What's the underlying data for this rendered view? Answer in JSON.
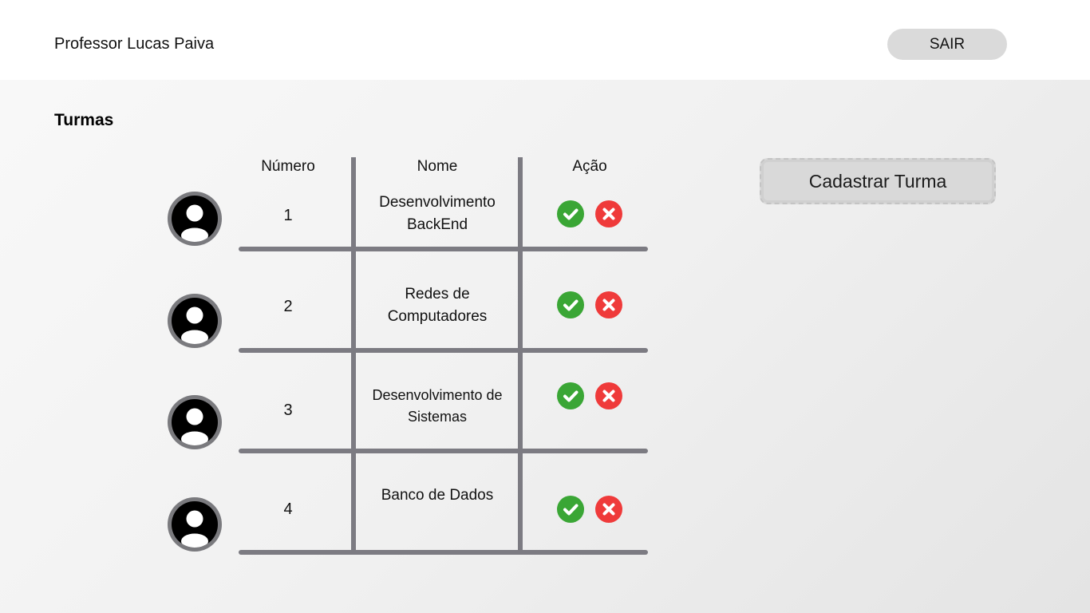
{
  "header": {
    "user_name": "Professor Lucas Paiva",
    "logout_label": "SAIR"
  },
  "section_title": "Turmas",
  "register_button_label": "Cadastrar Turma",
  "table": {
    "columns": [
      "Número",
      "Nome",
      "Ação"
    ],
    "rows": [
      {
        "number": "1",
        "name_line1": "Desenvolvimento",
        "name_line2": "BackEnd"
      },
      {
        "number": "2",
        "name_line1": "Redes de",
        "name_line2": "Computadores"
      },
      {
        "number": "3",
        "name_line1": "Desenvolvimento de",
        "name_line2": "Sistemas"
      },
      {
        "number": "4",
        "name_line1": "Banco de Dados",
        "name_line2": ""
      }
    ]
  },
  "icons": {
    "avatar": "user-avatar-icon",
    "approve": "check-circle-icon",
    "delete": "x-circle-icon"
  },
  "colors": {
    "approve": "#3aa635",
    "delete": "#ef3a3a",
    "table_lines": "#7c7b82",
    "button_bg": "#dadada"
  }
}
